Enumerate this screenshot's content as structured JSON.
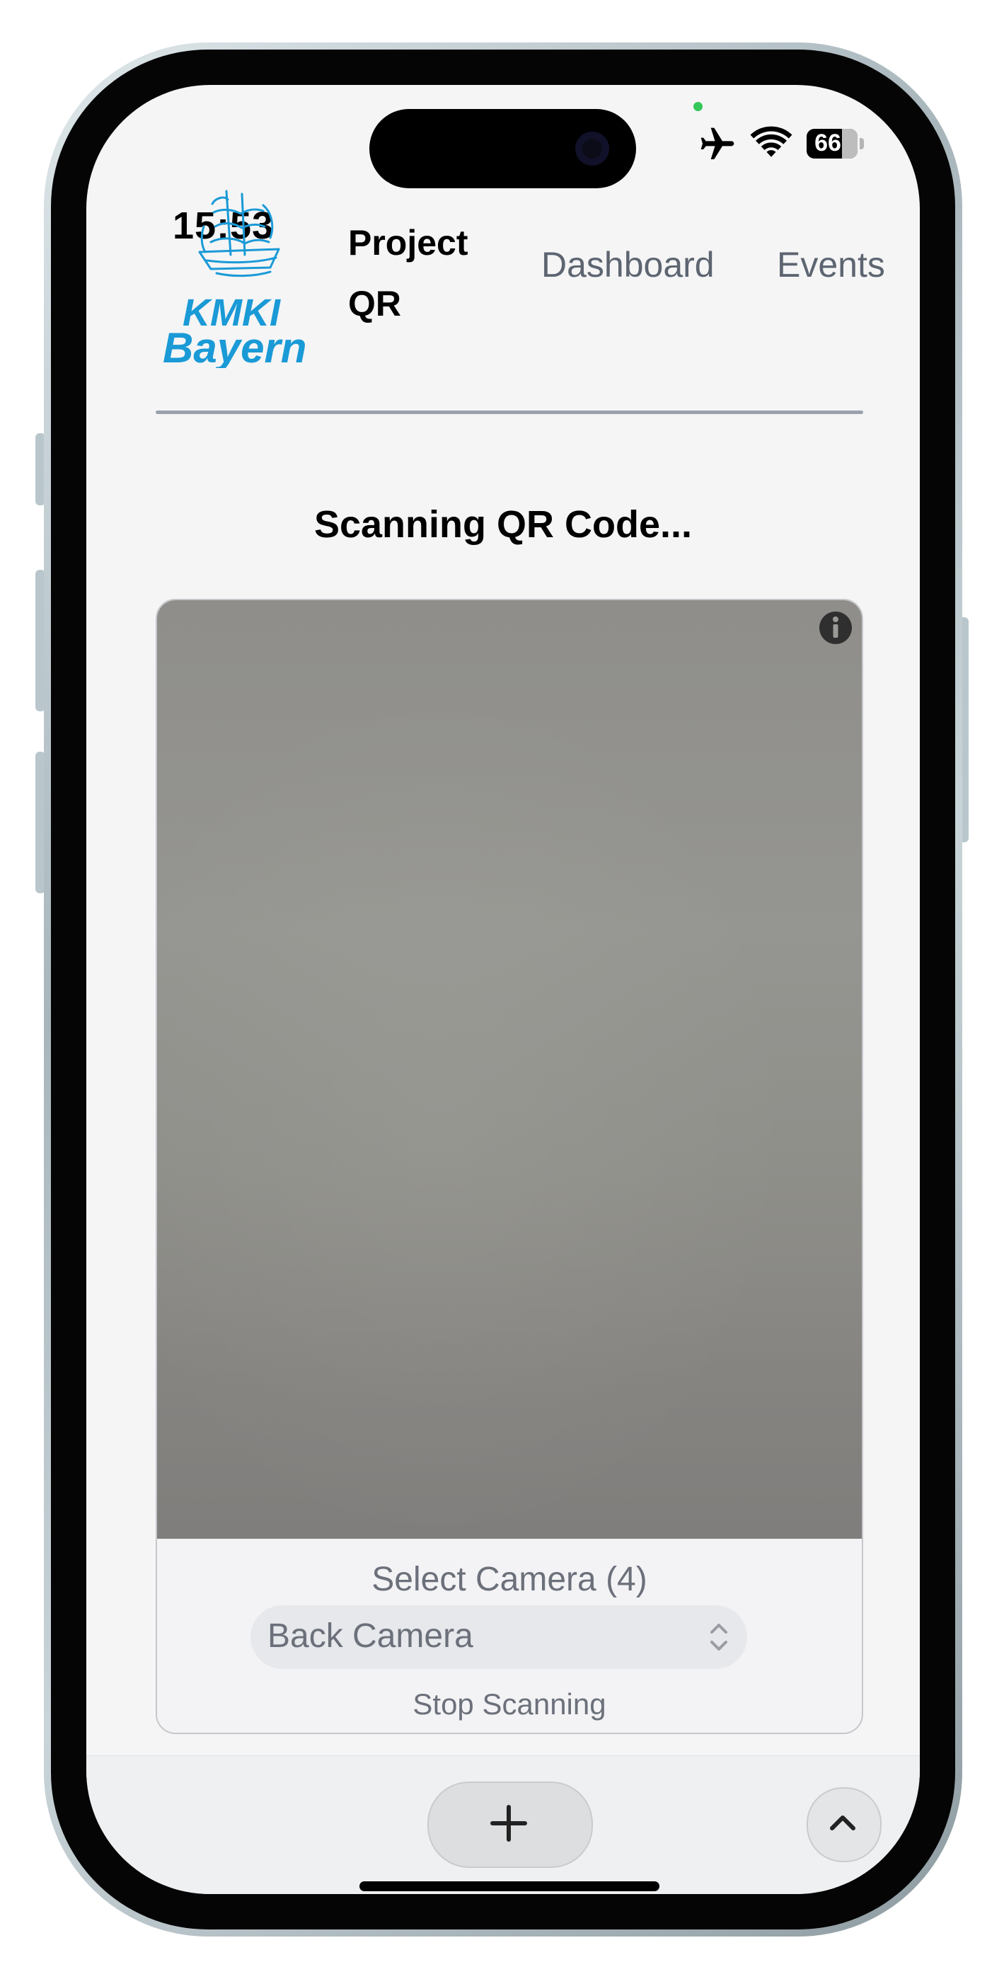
{
  "status_bar": {
    "time": "15:53",
    "battery": "66",
    "icons": [
      "airplane-icon",
      "wifi-icon",
      "battery-icon"
    ]
  },
  "header": {
    "logo_text": "KMKI Bayern",
    "brand": "Project QR",
    "nav": [
      {
        "label": "Dashboard"
      },
      {
        "label": "Events"
      }
    ]
  },
  "scanner": {
    "title": "Scanning QR Code...",
    "select_label": "Select Camera (4)",
    "selected_camera": "Back Camera",
    "camera_options": [
      "Back Camera"
    ],
    "stop_label": "Stop Scanning"
  },
  "bottom_bar": {
    "icons": [
      "plus-icon",
      "chevron-up-icon"
    ]
  },
  "colors": {
    "logo_blue": "#1a9ad6",
    "nav_text": "#5d6571",
    "divider": "#9aa1ad",
    "camera_feed": "#8f8e8a",
    "page_bg": "#f5f5f6"
  }
}
